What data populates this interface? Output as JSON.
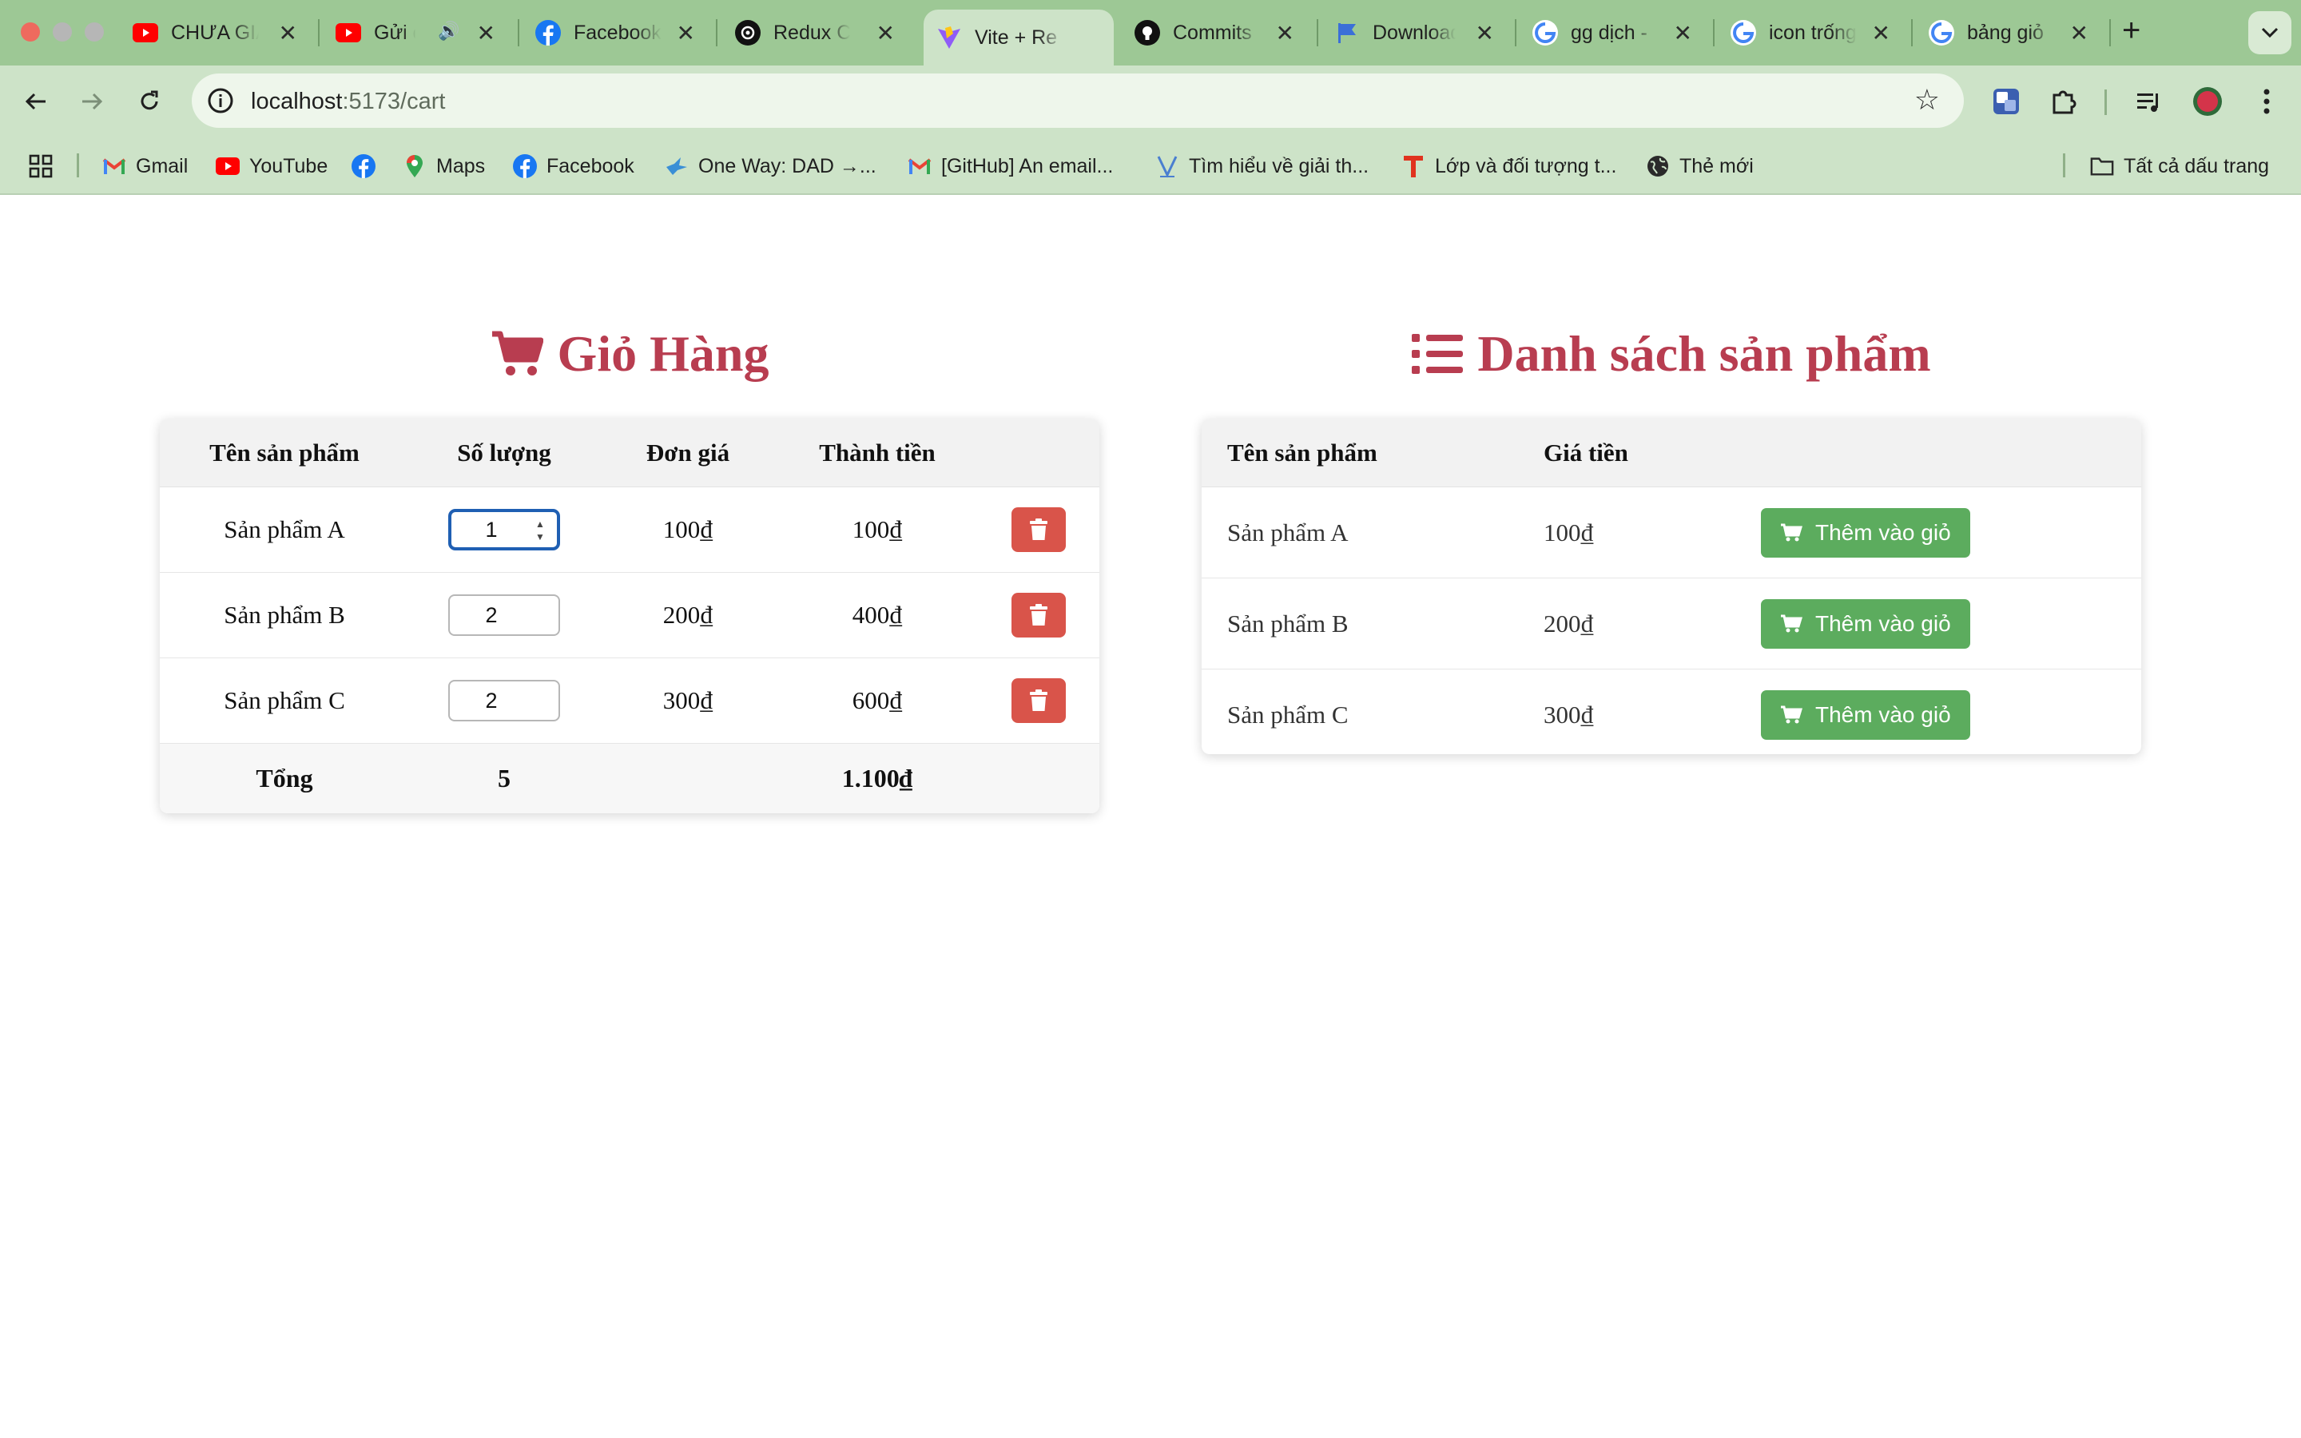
{
  "browser": {
    "tabs": [
      {
        "title": "CHƯA GIÁ",
        "favicon": "youtube-icon",
        "color": "#ff0000"
      },
      {
        "title": "Gửi đi",
        "favicon": "youtube-icon",
        "color": "#ff0000",
        "audio": true
      },
      {
        "title": "Facebook",
        "favicon": "facebook-icon",
        "color": "#1877f2"
      },
      {
        "title": "Redux Co",
        "favicon": "openai-icon",
        "color": "#111111"
      },
      {
        "title": "Vite + Re",
        "favicon": "vite-icon",
        "color": "#a855f7",
        "active": true
      },
      {
        "title": "Commits",
        "favicon": "github-icon",
        "color": "#111111"
      },
      {
        "title": "Download",
        "favicon": "flag-icon",
        "color": "#3b6fd8"
      },
      {
        "title": "gg dịch -",
        "favicon": "google-icon",
        "color": "#4285f4"
      },
      {
        "title": "icon trống",
        "favicon": "google-icon",
        "color": "#4285f4"
      },
      {
        "title": "bảng giỏ",
        "favicon": "google-icon",
        "color": "#4285f4"
      }
    ],
    "url_host": "localhost",
    "url_path": ":5173/cart",
    "bookmarks": [
      {
        "label": "Gmail",
        "icon": "gmail-icon"
      },
      {
        "label": "YouTube",
        "icon": "youtube-icon"
      },
      {
        "label": "",
        "icon": "facebook-icon"
      },
      {
        "label": "Maps",
        "icon": "maps-icon"
      },
      {
        "label": "Facebook",
        "icon": "facebook-icon"
      },
      {
        "label": "One Way: DAD →...",
        "icon": "bird-icon"
      },
      {
        "label": "[GitHub] An email...",
        "icon": "gmail-icon"
      },
      {
        "label": "Tìm hiểu về giải th...",
        "icon": "v-icon"
      },
      {
        "label": "Lớp và đối tượng t...",
        "icon": "t-icon"
      },
      {
        "label": "Thẻ mới",
        "icon": "globe-icon"
      }
    ],
    "all_bookmarks_label": "Tất cả dấu trang"
  },
  "cart": {
    "title": "Giỏ Hàng",
    "headers": {
      "name": "Tên sản phẩm",
      "qty": "Số lượng",
      "unit": "Đơn giá",
      "total": "Thành tiền"
    },
    "rows": [
      {
        "name": "Sản phẩm A",
        "qty": "1",
        "unit": "100₫",
        "total": "100₫"
      },
      {
        "name": "Sản phẩm B",
        "qty": "2",
        "unit": "200₫",
        "total": "400₫"
      },
      {
        "name": "Sản phẩm C",
        "qty": "2",
        "unit": "300₫",
        "total": "600₫"
      }
    ],
    "footer": {
      "label": "Tổng",
      "qty": "5",
      "total": "1.100₫"
    }
  },
  "products": {
    "title": "Danh sách sản phẩm",
    "headers": {
      "name": "Tên sản phẩm",
      "price": "Giá tiền"
    },
    "rows": [
      {
        "name": "Sản phẩm A",
        "price": "100₫",
        "button": "Thêm vào giỏ"
      },
      {
        "name": "Sản phẩm B",
        "price": "200₫",
        "button": "Thêm vào giỏ"
      },
      {
        "name": "Sản phẩm C",
        "price": "300₫",
        "button": "Thêm vào giỏ"
      }
    ]
  },
  "colors": {
    "title": "#b83d50",
    "delete": "#d9544a",
    "add": "#5cac5e",
    "tabstrip": "#9dc895",
    "toolbar": "#cde3c8"
  }
}
